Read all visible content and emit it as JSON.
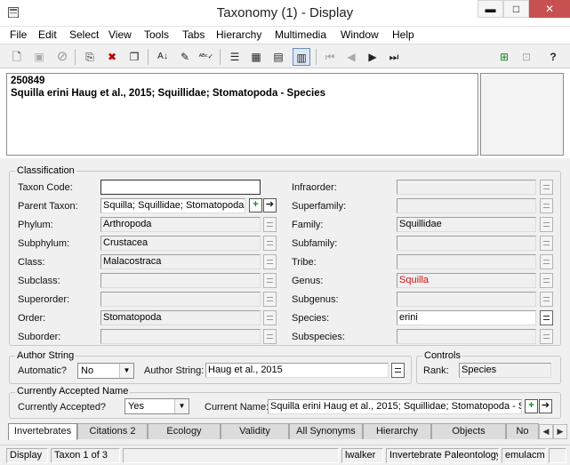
{
  "window": {
    "title": "Taxonomy (1) - Display",
    "buttons": {
      "minimize": "▬",
      "maximize": "□",
      "close": "✕"
    }
  },
  "menu": [
    "File",
    "Edit",
    "Select",
    "View",
    "Tools",
    "Tabs",
    "Hierarchy",
    "Multimedia",
    "Window",
    "Help"
  ],
  "toolbar_icons": [
    "new-record-icon",
    "save-icon",
    "cancel-icon",
    "open-icon",
    "delete-icon",
    "copy-record-icon",
    "sort-icon",
    "edit-icon",
    "spellcheck-icon",
    "list-view-icon",
    "grid-view-icon",
    "page-view-icon",
    "record-view-icon",
    "first-record-icon",
    "previous-record-icon",
    "next-record-icon",
    "last-record-icon",
    "attach-icon",
    "detach-icon",
    "help-icon"
  ],
  "summary": {
    "irn": "250849",
    "description": "Squilla erini Haug et al., 2015; Squillidae; Stomatopoda - Species"
  },
  "classification": {
    "title": "Classification",
    "left": [
      {
        "label": "Taxon Code:",
        "value": ""
      },
      {
        "label": "Parent Taxon:",
        "value": "Squilla; Squillidae; Stomatopoda -"
      },
      {
        "label": "Phylum:",
        "value": "Arthropoda"
      },
      {
        "label": "Subphylum:",
        "value": "Crustacea"
      },
      {
        "label": "Class:",
        "value": "Malacostraca"
      },
      {
        "label": "Subclass:",
        "value": ""
      },
      {
        "label": "Superorder:",
        "value": ""
      },
      {
        "label": "Order:",
        "value": "Stomatopoda"
      },
      {
        "label": "Suborder:",
        "value": ""
      }
    ],
    "right": [
      {
        "label": "Infraorder:",
        "value": ""
      },
      {
        "label": "Superfamily:",
        "value": ""
      },
      {
        "label": "Family:",
        "value": "Squillidae"
      },
      {
        "label": "Subfamily:",
        "value": ""
      },
      {
        "label": "Tribe:",
        "value": ""
      },
      {
        "label": "Genus:",
        "value": "Squilla"
      },
      {
        "label": "Subgenus:",
        "value": ""
      },
      {
        "label": "Species:",
        "value": "erini"
      },
      {
        "label": "Subspecies:",
        "value": ""
      }
    ]
  },
  "author": {
    "title": "Author String",
    "automatic_label": "Automatic?",
    "automatic_value": "No",
    "author_label": "Author String:",
    "author_value": "Haug et al., 2015"
  },
  "controls": {
    "title": "Controls",
    "rank_label": "Rank:",
    "rank_value": "Species"
  },
  "accepted": {
    "title": "Currently Accepted Name",
    "accepted_label": "Currently Accepted?",
    "accepted_value": "Yes",
    "current_label": "Current Name:",
    "current_value": "Squilla erini Haug et al., 2015; Squillidae; Stomatopoda - Sp"
  },
  "tabs": [
    "Invertebrates",
    "Citations 2",
    "Ecology",
    "Validity",
    "All Synonyms",
    "Hierarchy",
    "Objects",
    "No"
  ],
  "status": [
    "Display",
    "Taxon 1 of 3",
    "",
    "lwalker",
    "Invertebrate Paleontology",
    "emulacm",
    ""
  ],
  "colors": {
    "genus_text": "#d01010",
    "close_button": "#c75050"
  }
}
